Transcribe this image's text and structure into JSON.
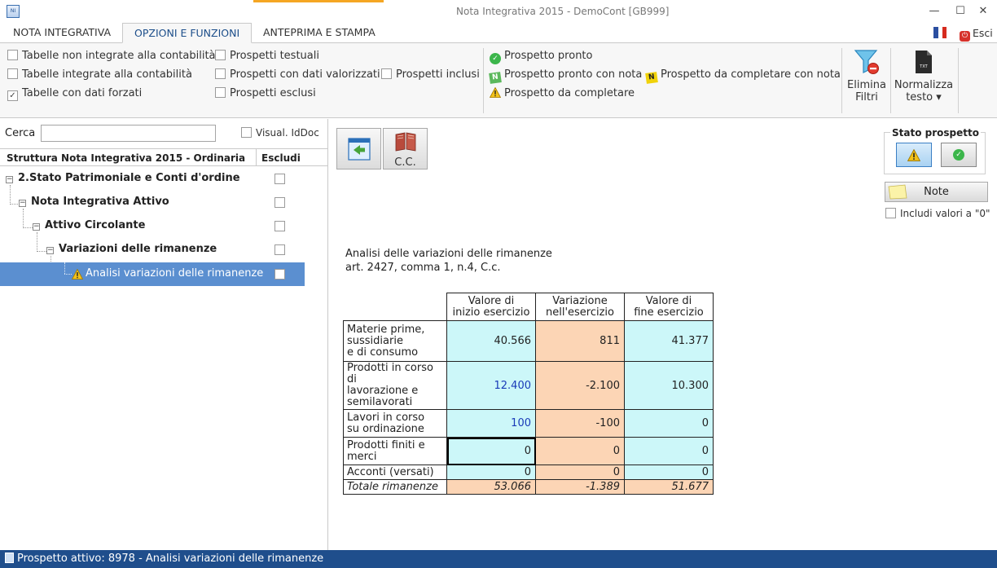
{
  "window": {
    "title": "Nota Integrativa 2015 - DemoCont [GB999]",
    "minimize": "—",
    "maximize": "☐",
    "close": "✕"
  },
  "tabs": [
    {
      "label": "NOTA INTEGRATIVA",
      "active": false
    },
    {
      "label": "OPZIONI E FUNZIONI",
      "active": true
    },
    {
      "label": "ANTEPRIMA E STAMPA",
      "active": false
    }
  ],
  "exit_label": "Esci",
  "filters": {
    "col1": [
      {
        "label": "Tabelle non integrate alla contabilità",
        "checked": false
      },
      {
        "label": "Tabelle integrate alla contabilità",
        "checked": false
      },
      {
        "label": "Tabelle con dati forzati",
        "checked": true
      }
    ],
    "col2": [
      {
        "label": "Prospetti testuali",
        "checked": false
      },
      {
        "label": "Prospetti con dati valorizzati",
        "checked": false
      },
      {
        "label": "Prospetti esclusi",
        "checked": false
      }
    ],
    "col3": [
      {
        "label": "Prospetti inclusi",
        "checked": false
      }
    ]
  },
  "legend": {
    "pronto": "Prospetto pronto",
    "pronto_nota": "Prospetto pronto con nota",
    "completare_nota": "Prospetto da completare con nota",
    "completare": "Prospetto da completare"
  },
  "ribbon_buttons": {
    "elimina_filtri": [
      "Elimina",
      "Filtri"
    ],
    "normalizza": [
      "Normalizza",
      "testo ▾"
    ],
    "txt_icon_text": "TXT"
  },
  "search": {
    "label": "Cerca",
    "value": "",
    "visual_iddoc": "Visual. IdDoc"
  },
  "tree": {
    "header": "Struttura Nota Integrativa 2015 - Ordinaria",
    "exclude_header": "Escludi",
    "nodes": [
      {
        "label": "2.Stato Patrimoniale e Conti d'ordine"
      },
      {
        "label": "Nota Integrativa Attivo"
      },
      {
        "label": "Attivo Circolante"
      },
      {
        "label": "Variazioni delle rimanenze"
      },
      {
        "label": "Analisi variazioni delle rimanenze"
      }
    ]
  },
  "toolbar": {
    "cc_label": "C.C."
  },
  "stato": {
    "title": "Stato prospetto"
  },
  "note_button": "Note",
  "include_zero": "Includi valori a \"0\"",
  "caption": {
    "line1": "Analisi delle variazioni delle rimanenze",
    "line2": "art. 2427, comma 1, n.4, C.c."
  },
  "table": {
    "headers": [
      [
        "Valore di",
        "inizio esercizio"
      ],
      [
        "Variazione",
        "nell'esercizio"
      ],
      [
        "Valore di",
        "fine esercizio"
      ]
    ],
    "rows": [
      {
        "label": [
          "Materie prime,",
          "sussidiarie",
          "e di consumo"
        ],
        "values": [
          "40.566",
          "811",
          "41.377"
        ]
      },
      {
        "label": [
          "Prodotti in corso di",
          "lavorazione e",
          "semilavorati"
        ],
        "values": [
          "12.400",
          "-2.100",
          "10.300"
        ]
      },
      {
        "label": [
          "Lavori in corso",
          "su ordinazione"
        ],
        "values": [
          "100",
          "-100",
          "0"
        ]
      },
      {
        "label": [
          "Prodotti finiti e",
          "merci"
        ],
        "values": [
          "0",
          "0",
          "0"
        ]
      },
      {
        "label": [
          "Acconti (versati)"
        ],
        "values": [
          "0",
          "0",
          "0"
        ]
      }
    ],
    "total": {
      "label": "Totale rimanenze",
      "values": [
        "53.066",
        "-1.389",
        "51.677"
      ]
    }
  },
  "status": "Prospetto attivo: 8978 - Analisi variazioni delle rimanenze",
  "colors": {
    "accent": "#1f4e8c",
    "selection": "#5b8fd0",
    "cyan_cell": "#ccf7f9",
    "peach_cell": "#fcd5b5",
    "tab_highlight": "#f5a623"
  }
}
